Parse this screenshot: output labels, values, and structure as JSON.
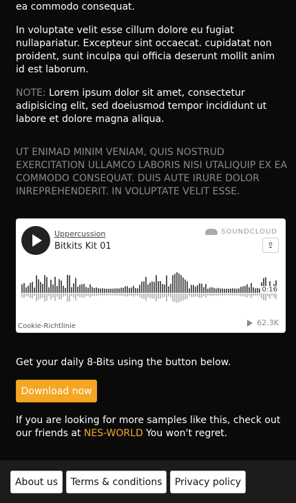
{
  "text": {
    "p1": "ea commodo consequat.",
    "p2": "In voluptate velit esse cillum dolore eu fugiat nullapariatur. Excepteur sint occaecat. cupidatat non proident, sunt inculpa qui officia deserunt mollit anim id est laborum.",
    "note_label": "NOTE:",
    "note_text": " Lorem ipsum dolor sit amet, consectetur adipisicing elit, sed doeiusmod tempor incididunt ut labore et dolore magna aliqua.",
    "upper": "Ut enimad minim veniam, quis nostrud exercitation ullamco laboris nisi utaliquip ex ea commodo consequat. Duis aute irure dolor inreprehenderit. in voluptate velit esse.",
    "daily": "Get your daily 8-Bits using the button below.",
    "friends_pre": "If you are looking for more samples like this, check out our friends at ",
    "friends_link": "NES-WORLD",
    "friends_post": " You won't regret."
  },
  "soundcloud": {
    "user": "Uppercussion",
    "track": "Bitkits Kit 01",
    "brand": "SOUNDCLOUD",
    "time": "0:16",
    "cookie": "Cookie-Richtlinie",
    "plays": "62.3K"
  },
  "buttons": {
    "download": "Download now"
  },
  "footer": {
    "about": "About us",
    "terms": "Terms & conditions",
    "privacy": "Privacy policy"
  },
  "colors": {
    "accent": "#f5a623",
    "background": "#0a0a0a",
    "muted": "#8a8a8a"
  }
}
